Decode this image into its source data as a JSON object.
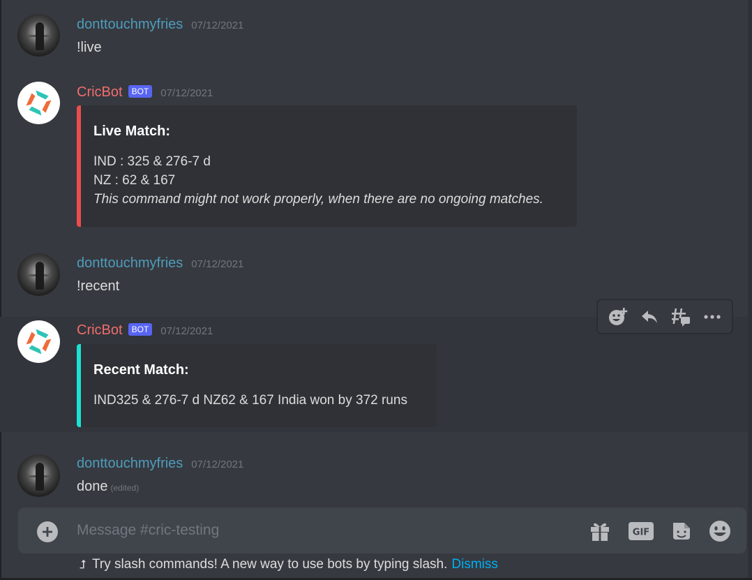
{
  "messages": [
    {
      "username": "donttouchmyfries",
      "timestamp": "07/12/2021",
      "text": "!live"
    },
    {
      "username": "CricBot",
      "badge": "BOT",
      "timestamp": "07/12/2021",
      "embed": {
        "accent": "#ec4d4d",
        "title": "Live Match:",
        "lines": [
          "IND : 325 & 276-7 d",
          "NZ : 62 & 167"
        ],
        "note": "This command might not work properly, when there are no ongoing matches."
      }
    },
    {
      "username": "donttouchmyfries",
      "timestamp": "07/12/2021",
      "text": "!recent"
    },
    {
      "username": "CricBot",
      "badge": "BOT",
      "timestamp": "07/12/2021",
      "embed": {
        "accent": "#19e3d3",
        "title": "Recent Match:",
        "lines": [
          "IND325 & 276-7 d NZ62 & 167 India won by 372 runs"
        ]
      }
    },
    {
      "username": "donttouchmyfries",
      "timestamp": "07/12/2021",
      "text": "done",
      "edited": "(edited)"
    }
  ],
  "hover_toolbar": {
    "icons": [
      "add-reaction-icon",
      "reply-icon",
      "create-thread-icon",
      "more-icon"
    ]
  },
  "composer": {
    "placeholder": "Message #cric-testing",
    "icons": [
      "gift-icon",
      "gif-icon",
      "sticker-icon",
      "emoji-icon"
    ],
    "gif_label": "GIF"
  },
  "hint": {
    "text": "Try slash commands! A new way to use bots by typing slash.",
    "dismiss": "Dismiss"
  },
  "colors": {
    "background": "#36393f",
    "user_name": "#4f9cbd",
    "bot_name": "#f26d6d",
    "bot_badge": "#5865f2",
    "link": "#00b0f4"
  }
}
